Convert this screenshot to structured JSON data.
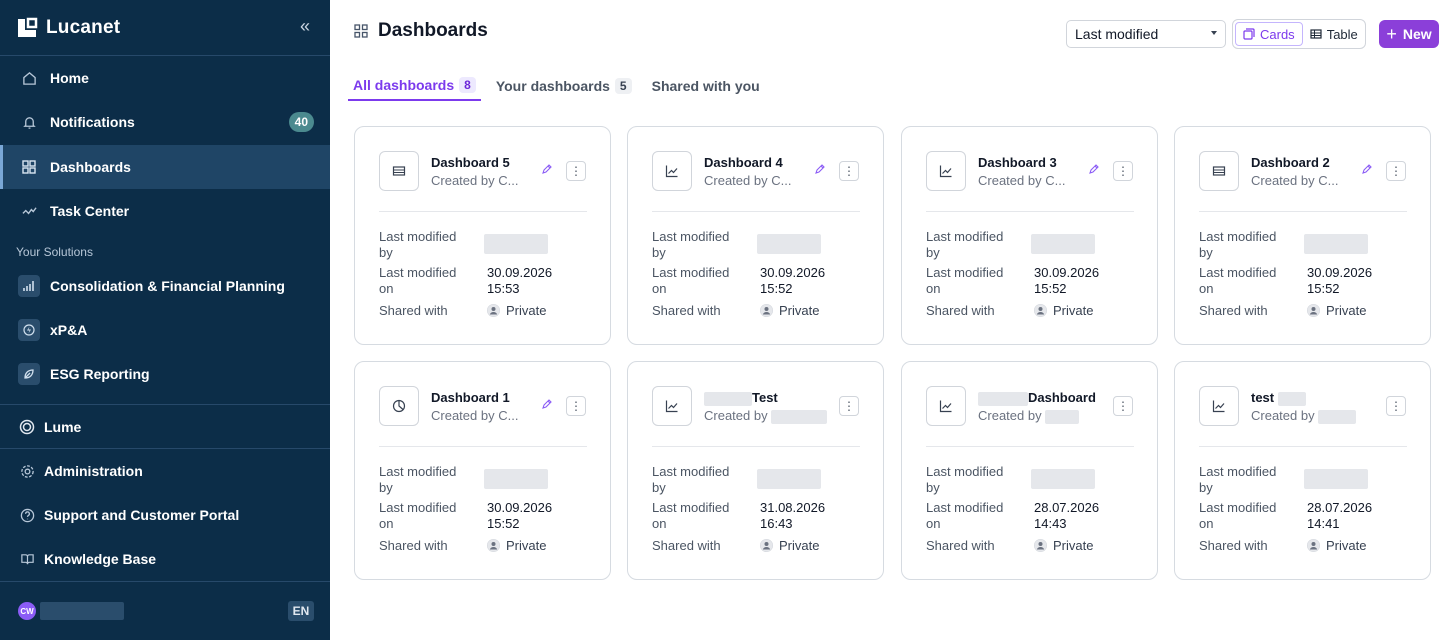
{
  "sidebar": {
    "brand": "Lucanet",
    "collapse_icon": "double-chevron-left-icon",
    "items": [
      {
        "label": "Home",
        "icon": "home-icon"
      },
      {
        "label": "Notifications",
        "icon": "bell-icon",
        "badge": "40"
      },
      {
        "label": "Dashboards",
        "icon": "grid-icon",
        "active": true
      },
      {
        "label": "Task Center",
        "icon": "check-wave-icon"
      }
    ],
    "section_label": "Your Solutions",
    "solutions": [
      {
        "label": "Consolidation & Financial Planning",
        "icon": "bar-chart-icon"
      },
      {
        "label": "xP&A",
        "icon": "bolt-icon"
      },
      {
        "label": "ESG Reporting",
        "icon": "leaf-icon"
      }
    ],
    "lume": {
      "label": "Lume",
      "icon": "ring-icon"
    },
    "bottom": [
      {
        "label": "Administration",
        "icon": "gear-icon"
      },
      {
        "label": "Support and Customer Portal",
        "icon": "help-circle-icon"
      },
      {
        "label": "Knowledge Base",
        "icon": "book-icon"
      }
    ],
    "user": {
      "initials": "CW",
      "language": "EN"
    }
  },
  "header": {
    "title": "Dashboards",
    "sort": {
      "selected": "Last modified"
    },
    "view": {
      "cards_label": "Cards",
      "table_label": "Table",
      "active": "Cards"
    },
    "new_label": "New"
  },
  "tabs": [
    {
      "label": "All dashboards",
      "count": "8",
      "active": true
    },
    {
      "label": "Your dashboards",
      "count": "5"
    },
    {
      "label": "Shared with you",
      "count": ""
    }
  ],
  "labels": {
    "modified_by_1": "Last modified",
    "modified_by_2": "by",
    "modified_on_1": "Last modified",
    "modified_on_2": "on",
    "shared_with": "Shared with",
    "private": "Private"
  },
  "cards": [
    {
      "title": "Dashboard 5",
      "subtitle": "Created by C...",
      "date": "30.09.2026",
      "time": "15:53",
      "icon": "table-icon",
      "editable": true
    },
    {
      "title": "Dashboard 4",
      "subtitle": "Created by C...",
      "date": "30.09.2026",
      "time": "15:52",
      "icon": "line-chart-icon",
      "editable": true
    },
    {
      "title": "Dashboard 3",
      "subtitle": "Created by C...",
      "date": "30.09.2026",
      "time": "15:52",
      "icon": "line-chart-icon",
      "editable": true
    },
    {
      "title": "Dashboard 2",
      "subtitle": "Created by C...",
      "date": "30.09.2026",
      "time": "15:52",
      "icon": "table-icon",
      "editable": true
    },
    {
      "title": "Dashboard 1",
      "subtitle": "Created by C...",
      "date": "30.09.2026",
      "time": "15:52",
      "icon": "pie-chart-icon",
      "editable": true
    },
    {
      "title": "Test",
      "subtitle": "Created by",
      "date": "31.08.2026",
      "time": "16:43",
      "icon": "line-chart-icon",
      "editable": false
    },
    {
      "title": "Dashboard",
      "subtitle": "Created by",
      "date": "28.07.2026",
      "time": "14:43",
      "icon": "line-chart-icon",
      "editable": false
    },
    {
      "title": "test",
      "subtitle": "Created by",
      "date": "28.07.2026",
      "time": "14:41",
      "icon": "line-chart-icon",
      "editable": false
    }
  ],
  "colors": {
    "sidebar_bg": "#0c2d48",
    "accent": "#8b3fd9",
    "badge": "#4b8a8f"
  }
}
